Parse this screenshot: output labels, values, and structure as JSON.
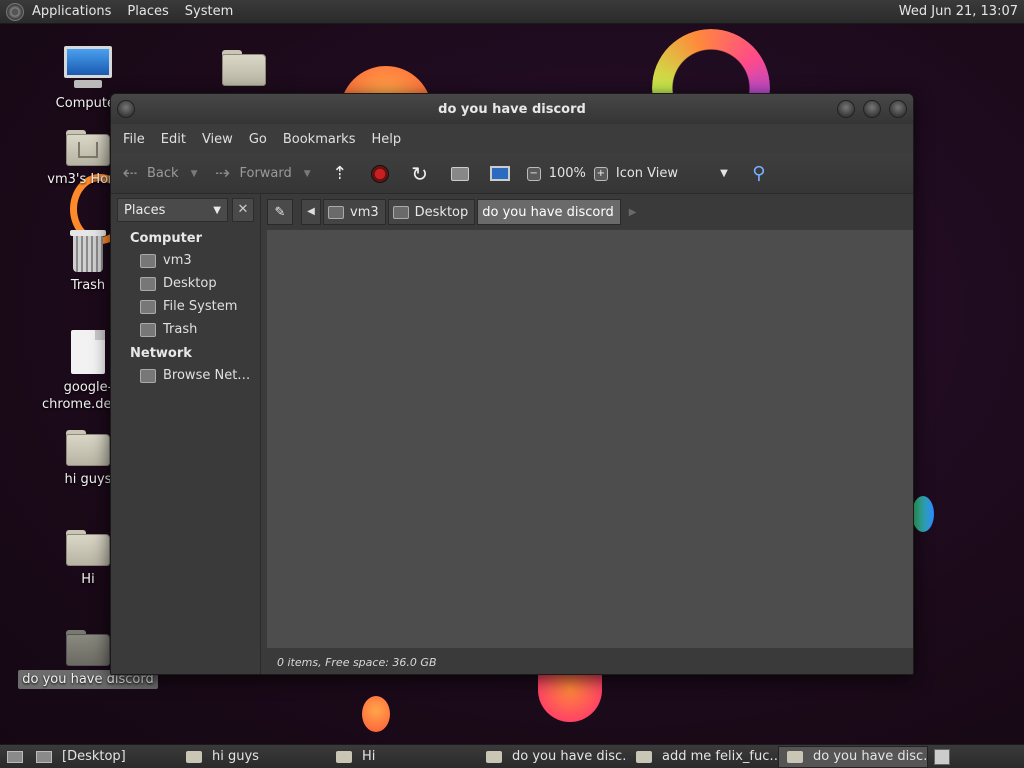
{
  "top_panel": {
    "menus": [
      "Applications",
      "Places",
      "System"
    ],
    "clock": "Wed Jun 21, 13:07"
  },
  "desktop_icons": {
    "computer": "Computer",
    "home": "vm3's Home",
    "trash": "Trash",
    "chrome": "google-chrome.desktop",
    "hi_guys": "hi guys",
    "hi": "Hi",
    "discord": "do you have discord"
  },
  "window": {
    "title": "do you have discord",
    "menu": [
      "File",
      "Edit",
      "View",
      "Go",
      "Bookmarks",
      "Help"
    ],
    "toolbar": {
      "back": "Back",
      "forward": "Forward",
      "zoom": "100%",
      "view_mode": "Icon View"
    },
    "sidebar": {
      "selector": "Places",
      "sections": [
        {
          "title": "Computer",
          "items": [
            "vm3",
            "Desktop",
            "File System",
            "Trash"
          ]
        },
        {
          "title": "Network",
          "items": [
            "Browse Net…"
          ]
        }
      ]
    },
    "path": [
      "vm3",
      "Desktop",
      "do you have discord"
    ],
    "status": "0 items, Free space: 36.0 GB"
  },
  "taskbar": {
    "items": [
      {
        "label": "[Desktop]",
        "icon": "desktop-icon",
        "active": false
      },
      {
        "label": "hi guys",
        "icon": "folder-icon",
        "active": false
      },
      {
        "label": "Hi",
        "icon": "folder-icon",
        "active": false
      },
      {
        "label": "do you have disc…",
        "icon": "folder-icon",
        "active": false
      },
      {
        "label": "add me felix_fuc…",
        "icon": "folder-icon",
        "active": false
      },
      {
        "label": "do you have disc…",
        "icon": "folder-icon",
        "active": true
      }
    ]
  }
}
